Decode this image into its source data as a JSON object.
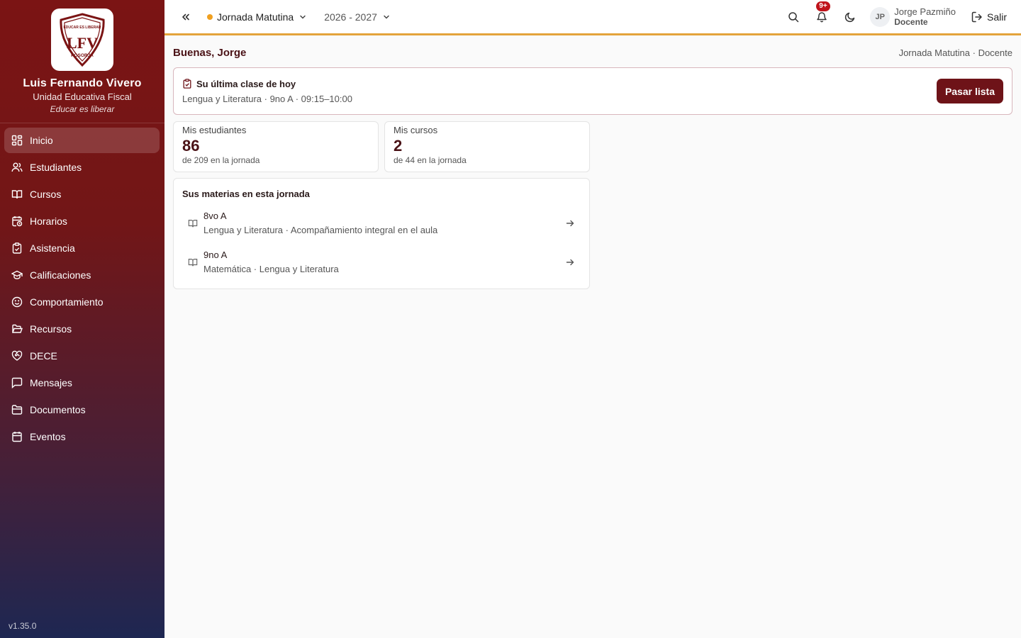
{
  "sidebar": {
    "brand_name": "Luis Fernando Vivero",
    "brand_sub": "Unidad Educativa Fiscal",
    "brand_motto": "Educar es liberar",
    "logo_text": "LFV",
    "logo_arc_text": "EDUCAR ES LIBERAR",
    "logo_bottom_text": "POSORJA",
    "items": [
      {
        "label": "Inicio",
        "icon": "dashboard-icon",
        "active": true
      },
      {
        "label": "Estudiantes",
        "icon": "users-icon"
      },
      {
        "label": "Cursos",
        "icon": "book-open-icon"
      },
      {
        "label": "Horarios",
        "icon": "calendar-clock-icon"
      },
      {
        "label": "Asistencia",
        "icon": "clipboard-check-icon"
      },
      {
        "label": "Calificaciones",
        "icon": "graduation-cap-icon"
      },
      {
        "label": "Comportamiento",
        "icon": "smile-icon"
      },
      {
        "label": "Recursos",
        "icon": "folder-open-icon"
      },
      {
        "label": "DECE",
        "icon": "heart-handshake-icon"
      },
      {
        "label": "Mensajes",
        "icon": "message-square-icon"
      },
      {
        "label": "Documentos",
        "icon": "folder-icon"
      },
      {
        "label": "Eventos",
        "icon": "calendar-icon"
      }
    ],
    "version": "v1.35.0"
  },
  "topbar": {
    "jornada": "Jornada Matutina",
    "year": "2026 - 2027",
    "notifications_badge": "9+",
    "user_initials": "JP",
    "user_name": "Jorge Pazmiño",
    "user_role": "Docente",
    "logout_label": "Salir"
  },
  "main": {
    "greeting": "Buenas, Jorge",
    "context": "Jornada Matutina · Docente",
    "last_class": {
      "title": "Su última clase de hoy",
      "info": "Lengua y Literatura · 9no A · 09:15–10:00",
      "button": "Pasar lista"
    },
    "stats": [
      {
        "label": "Mis estudiantes",
        "value": "86",
        "sub": "de 209 en la jornada"
      },
      {
        "label": "Mis cursos",
        "value": "2",
        "sub": "de 44 en la jornada"
      }
    ],
    "materias": {
      "title": "Sus materias en esta jornada",
      "items": [
        {
          "course": "8vo A",
          "subjects": "Lengua y Literatura · Acompañamiento integral en el aula"
        },
        {
          "course": "9no A",
          "subjects": "Matemática · Lengua y Literatura"
        }
      ]
    }
  },
  "colors": {
    "brand": "#7b1414",
    "accent": "#e3a33b",
    "primary_button": "#6e1318",
    "jornada_dot": "#f0a020"
  }
}
